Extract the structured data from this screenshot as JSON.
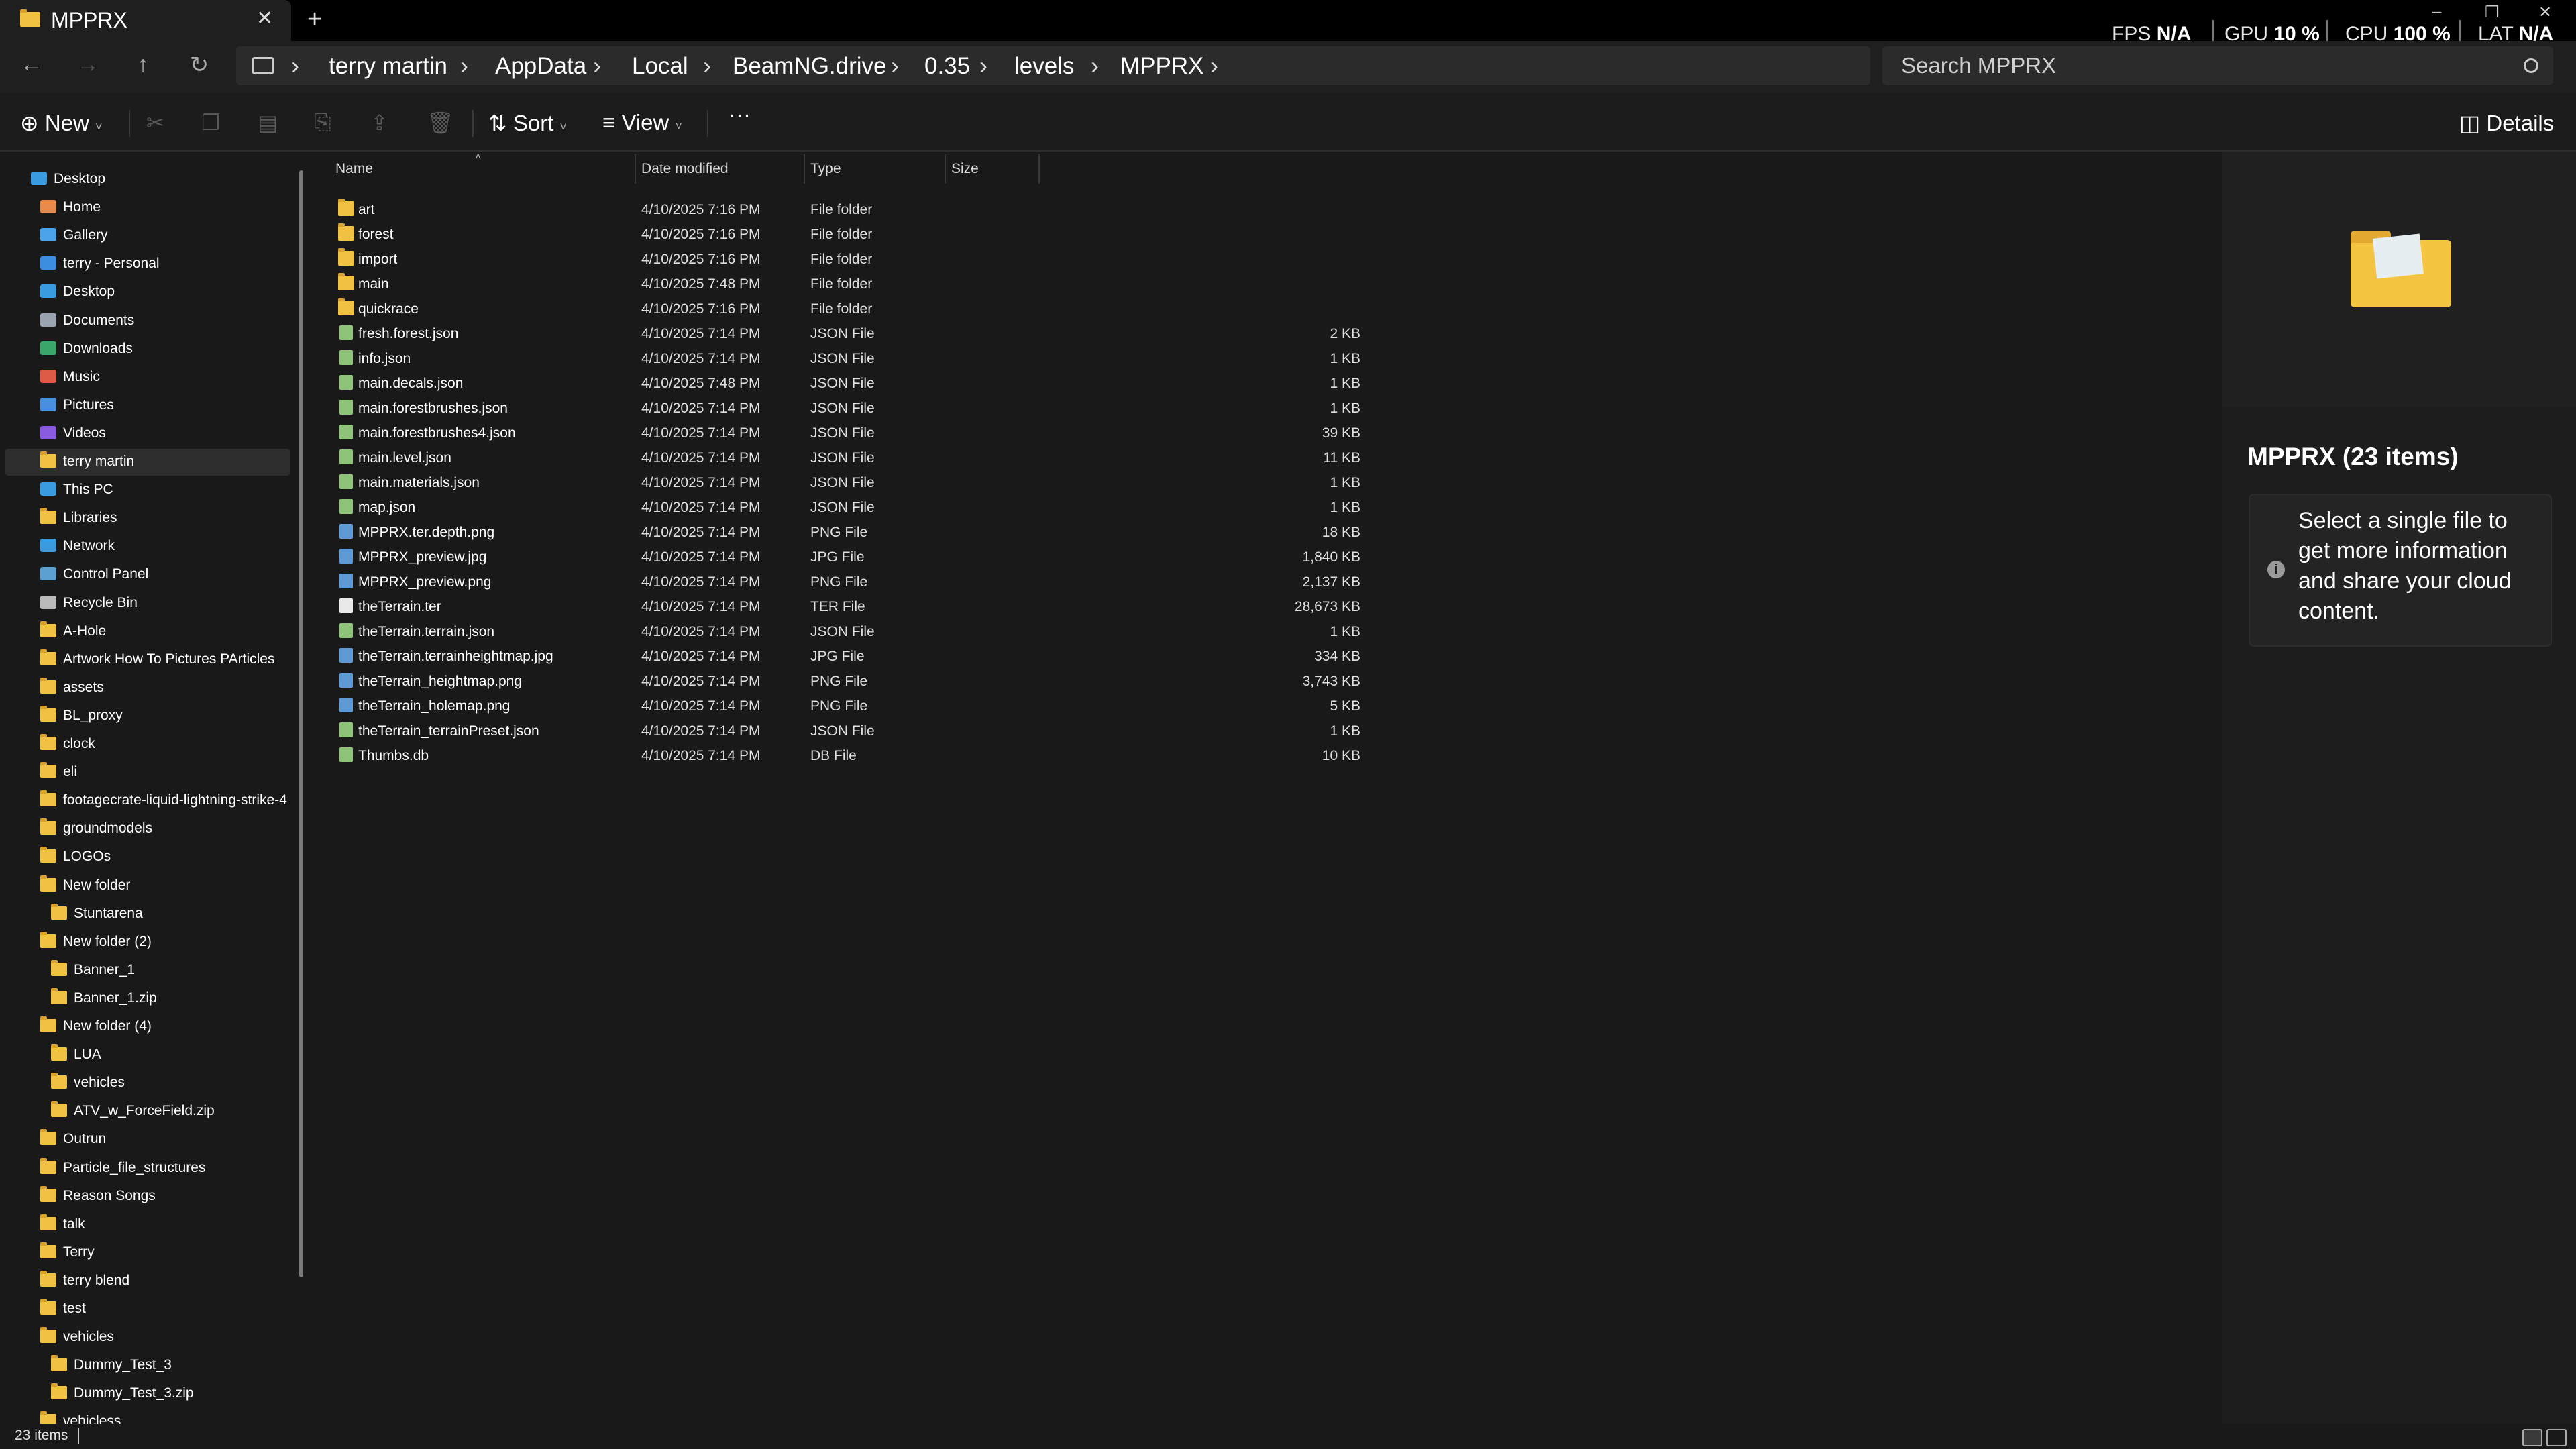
{
  "tab": {
    "title": "MPPRX"
  },
  "perf": {
    "fps_label": "FPS",
    "fps_value": "N/A",
    "gpu_label": "GPU",
    "gpu_value": "10 %",
    "cpu_label": "CPU",
    "cpu_value": "100 %",
    "lat_label": "LAT",
    "lat_value": "N/A"
  },
  "breadcrumb": [
    "terry martin",
    "AppData",
    "Local",
    "BeamNG.drive",
    "0.35",
    "levels",
    "MPPRX"
  ],
  "search": {
    "placeholder": "Search MPPRX"
  },
  "commands": {
    "new": "New",
    "sort": "Sort",
    "view": "View",
    "more": "···",
    "details": "Details"
  },
  "nav": {
    "items": [
      {
        "label": "Desktop",
        "icon": "desktop-icon",
        "level": 0
      },
      {
        "label": "Home",
        "icon": "home-icon",
        "level": 1
      },
      {
        "label": "Gallery",
        "icon": "gallery-icon",
        "level": 1
      },
      {
        "label": "terry - Personal",
        "icon": "onedrive-icon",
        "level": 1
      },
      {
        "label": "Desktop",
        "icon": "desktop-icon",
        "level": 1
      },
      {
        "label": "Documents",
        "icon": "documents-icon",
        "level": 1
      },
      {
        "label": "Downloads",
        "icon": "downloads-icon",
        "level": 1
      },
      {
        "label": "Music",
        "icon": "music-icon",
        "level": 1
      },
      {
        "label": "Pictures",
        "icon": "pictures-icon",
        "level": 1
      },
      {
        "label": "Videos",
        "icon": "videos-icon",
        "level": 1
      },
      {
        "label": "terry martin",
        "icon": "folder-icon",
        "level": 1,
        "selected": true
      },
      {
        "label": "This PC",
        "icon": "this-pc-icon",
        "level": 1
      },
      {
        "label": "Libraries",
        "icon": "folder-icon",
        "level": 1
      },
      {
        "label": "Network",
        "icon": "network-icon",
        "level": 1
      },
      {
        "label": "Control Panel",
        "icon": "control-panel-icon",
        "level": 1
      },
      {
        "label": "Recycle Bin",
        "icon": "recycle-bin-icon",
        "level": 1
      },
      {
        "label": "A-Hole",
        "icon": "folder-icon",
        "level": 1
      },
      {
        "label": "Artwork How To Pictures PArticles",
        "icon": "folder-icon",
        "level": 1
      },
      {
        "label": "assets",
        "icon": "folder-icon",
        "level": 1
      },
      {
        "label": "BL_proxy",
        "icon": "folder-icon",
        "level": 1
      },
      {
        "label": "clock",
        "icon": "folder-icon",
        "level": 1
      },
      {
        "label": "eli",
        "icon": "folder-icon",
        "level": 1
      },
      {
        "label": "footagecrate-liquid-lightning-strike-4",
        "icon": "folder-icon",
        "level": 1
      },
      {
        "label": "groundmodels",
        "icon": "folder-icon",
        "level": 1
      },
      {
        "label": "LOGOs",
        "icon": "folder-icon",
        "level": 1
      },
      {
        "label": "New folder",
        "icon": "folder-icon",
        "level": 1
      },
      {
        "label": "Stuntarena",
        "icon": "folder-icon",
        "level": 2
      },
      {
        "label": "New folder (2)",
        "icon": "folder-icon",
        "level": 1
      },
      {
        "label": "Banner_1",
        "icon": "folder-icon",
        "level": 2
      },
      {
        "label": "Banner_1.zip",
        "icon": "folder-icon",
        "level": 2
      },
      {
        "label": "New folder (4)",
        "icon": "folder-icon",
        "level": 1
      },
      {
        "label": "LUA",
        "icon": "folder-icon",
        "level": 2
      },
      {
        "label": "vehicles",
        "icon": "folder-icon",
        "level": 2
      },
      {
        "label": "ATV_w_ForceField.zip",
        "icon": "folder-icon",
        "level": 2
      },
      {
        "label": "Outrun",
        "icon": "folder-icon",
        "level": 1
      },
      {
        "label": "Particle_file_structures",
        "icon": "folder-icon",
        "level": 1
      },
      {
        "label": "Reason Songs",
        "icon": "folder-icon",
        "level": 1
      },
      {
        "label": "talk",
        "icon": "folder-icon",
        "level": 1
      },
      {
        "label": "Terry",
        "icon": "folder-icon",
        "level": 1
      },
      {
        "label": "terry blend",
        "icon": "folder-icon",
        "level": 1
      },
      {
        "label": "test",
        "icon": "folder-icon",
        "level": 1
      },
      {
        "label": "vehicles",
        "icon": "folder-icon",
        "level": 1
      },
      {
        "label": "Dummy_Test_3",
        "icon": "folder-icon",
        "level": 2
      },
      {
        "label": "Dummy_Test_3.zip",
        "icon": "folder-icon",
        "level": 2
      },
      {
        "label": "vehicless",
        "icon": "folder-icon",
        "level": 1
      }
    ]
  },
  "columns": {
    "name": "Name",
    "date": "Date modified",
    "type": "Type",
    "size": "Size"
  },
  "files": [
    {
      "name": "art",
      "date": "4/10/2025 7:16 PM",
      "type": "File folder",
      "size": "",
      "kind": "folder"
    },
    {
      "name": "forest",
      "date": "4/10/2025 7:16 PM",
      "type": "File folder",
      "size": "",
      "kind": "folder"
    },
    {
      "name": "import",
      "date": "4/10/2025 7:16 PM",
      "type": "File folder",
      "size": "",
      "kind": "folder"
    },
    {
      "name": "main",
      "date": "4/10/2025 7:48 PM",
      "type": "File folder",
      "size": "",
      "kind": "folder"
    },
    {
      "name": "quickrace",
      "date": "4/10/2025 7:16 PM",
      "type": "File folder",
      "size": "",
      "kind": "folder"
    },
    {
      "name": "fresh.forest.json",
      "date": "4/10/2025 7:14 PM",
      "type": "JSON File",
      "size": "2 KB",
      "kind": "json"
    },
    {
      "name": "info.json",
      "date": "4/10/2025 7:14 PM",
      "type": "JSON File",
      "size": "1 KB",
      "kind": "json"
    },
    {
      "name": "main.decals.json",
      "date": "4/10/2025 7:48 PM",
      "type": "JSON File",
      "size": "1 KB",
      "kind": "json"
    },
    {
      "name": "main.forestbrushes.json",
      "date": "4/10/2025 7:14 PM",
      "type": "JSON File",
      "size": "1 KB",
      "kind": "json"
    },
    {
      "name": "main.forestbrushes4.json",
      "date": "4/10/2025 7:14 PM",
      "type": "JSON File",
      "size": "39 KB",
      "kind": "json"
    },
    {
      "name": "main.level.json",
      "date": "4/10/2025 7:14 PM",
      "type": "JSON File",
      "size": "11 KB",
      "kind": "json"
    },
    {
      "name": "main.materials.json",
      "date": "4/10/2025 7:14 PM",
      "type": "JSON File",
      "size": "1 KB",
      "kind": "json"
    },
    {
      "name": "map.json",
      "date": "4/10/2025 7:14 PM",
      "type": "JSON File",
      "size": "1 KB",
      "kind": "json"
    },
    {
      "name": "MPPRX.ter.depth.png",
      "date": "4/10/2025 7:14 PM",
      "type": "PNG File",
      "size": "18 KB",
      "kind": "img"
    },
    {
      "name": "MPPRX_preview.jpg",
      "date": "4/10/2025 7:14 PM",
      "type": "JPG File",
      "size": "1,840 KB",
      "kind": "img"
    },
    {
      "name": "MPPRX_preview.png",
      "date": "4/10/2025 7:14 PM",
      "type": "PNG File",
      "size": "2,137 KB",
      "kind": "img"
    },
    {
      "name": "theTerrain.ter",
      "date": "4/10/2025 7:14 PM",
      "type": "TER File",
      "size": "28,673 KB",
      "kind": "plain"
    },
    {
      "name": "theTerrain.terrain.json",
      "date": "4/10/2025 7:14 PM",
      "type": "JSON File",
      "size": "1 KB",
      "kind": "json"
    },
    {
      "name": "theTerrain.terrainheightmap.jpg",
      "date": "4/10/2025 7:14 PM",
      "type": "JPG File",
      "size": "334 KB",
      "kind": "img"
    },
    {
      "name": "theTerrain_heightmap.png",
      "date": "4/10/2025 7:14 PM",
      "type": "PNG File",
      "size": "3,743 KB",
      "kind": "img"
    },
    {
      "name": "theTerrain_holemap.png",
      "date": "4/10/2025 7:14 PM",
      "type": "PNG File",
      "size": "5 KB",
      "kind": "img"
    },
    {
      "name": "theTerrain_terrainPreset.json",
      "date": "4/10/2025 7:14 PM",
      "type": "JSON File",
      "size": "1 KB",
      "kind": "json"
    },
    {
      "name": "Thumbs.db",
      "date": "4/10/2025 7:14 PM",
      "type": "DB File",
      "size": "10 KB",
      "kind": "json"
    }
  ],
  "details": {
    "title": "MPPRX (23 items)",
    "message": "Select a single file to get more information and share your cloud content."
  },
  "status": {
    "count": "23 items"
  }
}
